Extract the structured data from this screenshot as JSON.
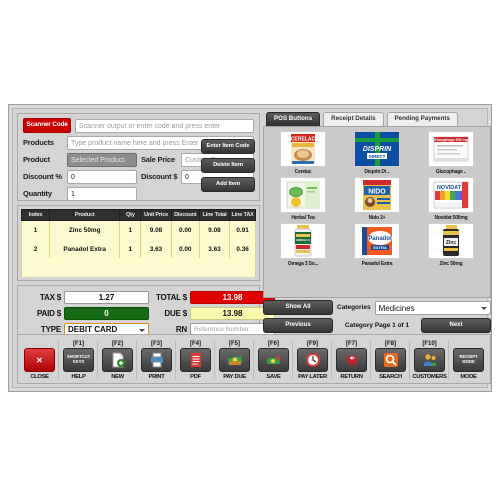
{
  "entry": {
    "scanner_button": "Scanner Code",
    "scanner_placeholder": "Scanner output or enter code and press enter",
    "products_label": "Products",
    "products_placeholder": "Type product name here and press Enter",
    "product_label": "Product",
    "selected_product": "Selected Product",
    "sale_price_label": "Sale Price",
    "sale_price_placeholder": "Custom Price",
    "discount_pct_label": "Discount %",
    "discount_pct_value": "0",
    "discount_amt_label": "Discount $",
    "discount_amt_value": "0",
    "quantity_label": "Quantity",
    "quantity_value": "1",
    "enter_item_code": "Enter Item Code",
    "delete_item": "Delete Item",
    "add_item": "Add Item"
  },
  "items_table": {
    "headers": [
      "Index",
      "Product",
      "Qty",
      "Unit Price",
      "Discount",
      "Line Total",
      "Line TAX"
    ],
    "rows": [
      [
        "1",
        "Zinc 50mg",
        "1",
        "9.08",
        "0.00",
        "9.08",
        "0.91"
      ],
      [
        "2",
        "Panadol Extra",
        "1",
        "3.63",
        "0.00",
        "3.63",
        "0.36"
      ]
    ]
  },
  "totals": {
    "tax_label": "TAX $",
    "tax_value": "1.27",
    "total_label": "TOTAL $",
    "total_value": "13.98",
    "paid_label": "PAID $",
    "paid_value": "0",
    "due_label": "DUE $",
    "due_value": "13.98",
    "type_label": "TYPE",
    "type_value": "DEBIT CARD",
    "rn_label": "RN",
    "rn_placeholder": "Reference Number"
  },
  "right_panel": {
    "tabs": [
      {
        "label": "POS Buttons",
        "active": true
      },
      {
        "label": "Receipt Details",
        "active": false
      },
      {
        "label": "Pending Payments",
        "active": false
      }
    ],
    "products": [
      {
        "name": "Cerelac",
        "brand": "CERELAC"
      },
      {
        "name": "Disprin Di ..",
        "brand": "DISPRIN"
      },
      {
        "name": "Glucophage ..",
        "brand": "Glucophage"
      },
      {
        "name": "Herbal Tea",
        "brand": "Herbal"
      },
      {
        "name": "Nido 2+",
        "brand": "NIDO"
      },
      {
        "name": "Novidat 500mg",
        "brand": "NOVIDAT"
      },
      {
        "name": "Omega 3 So...",
        "brand": "Omega 3"
      },
      {
        "name": "Panadol Extra",
        "brand": "Panadol"
      },
      {
        "name": "Zinc 50mg",
        "brand": "Zinc"
      }
    ],
    "show_all": "Show All",
    "categories_label": "Categories",
    "category_value": "Medicines",
    "previous": "Previous",
    "page_label": "Category Page 1 of 1",
    "next": "Next"
  },
  "toolbar": [
    {
      "fkey": "",
      "name": "CLOSE",
      "icon": "close-icon"
    },
    {
      "fkey": "[F1]",
      "name": "HELP",
      "icon": "shortcut-keys-icon",
      "icon_text": "SHORTCUT KEYS"
    },
    {
      "fkey": "[F2]",
      "name": "NEW",
      "icon": "new-document-icon"
    },
    {
      "fkey": "[F3]",
      "name": "PRINT",
      "icon": "printer-icon"
    },
    {
      "fkey": "[F4]",
      "name": "PDF",
      "icon": "pdf-icon"
    },
    {
      "fkey": "[F5]",
      "name": "PAY DUE",
      "icon": "money-icon"
    },
    {
      "fkey": "[F6]",
      "name": "SAVE",
      "icon": "save-money-icon"
    },
    {
      "fkey": "[F9]",
      "name": "PAY LATER",
      "icon": "clock-icon"
    },
    {
      "fkey": "[F7]",
      "name": "RETURN",
      "icon": "return-cart-icon"
    },
    {
      "fkey": "[F8]",
      "name": "SEARCH",
      "icon": "search-icon"
    },
    {
      "fkey": "[F10]",
      "name": "CUSTOMERS",
      "icon": "customers-icon"
    },
    {
      "fkey": "",
      "name": "MODE",
      "icon": "receipt-mode-icon",
      "icon_text": "RECEIPT MODE"
    }
  ],
  "colors": {
    "scanner_red": "#cc0000",
    "total_red": "#e00000",
    "paid_green": "#146b14",
    "due_yellow": "#fbfbb0",
    "type_orange": "#e08a20",
    "grid_yellow": "#f8f79a"
  }
}
